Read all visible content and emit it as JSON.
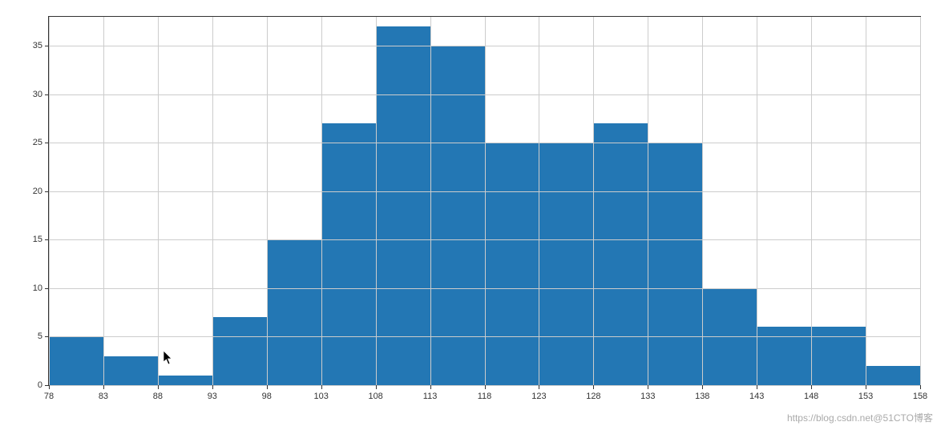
{
  "chart_data": {
    "type": "bar",
    "categories": [
      78,
      83,
      88,
      93,
      98,
      103,
      108,
      113,
      118,
      123,
      128,
      133,
      138,
      143,
      148,
      153
    ],
    "values": [
      5,
      3,
      1,
      7,
      15,
      27,
      37,
      35,
      25,
      25,
      27,
      25,
      10,
      6,
      6,
      2
    ],
    "title": "",
    "xlabel": "",
    "ylabel": "",
    "ylim": [
      0,
      38
    ],
    "y_ticks": [
      0,
      5,
      10,
      15,
      20,
      25,
      30,
      35
    ],
    "x_ticks": [
      78,
      83,
      88,
      93,
      98,
      103,
      108,
      113,
      118,
      123,
      128,
      133,
      138,
      143,
      148,
      153,
      158
    ],
    "bar_color": "#2377b4"
  },
  "watermark": "https://blog.csdn.net@51CTO博客"
}
